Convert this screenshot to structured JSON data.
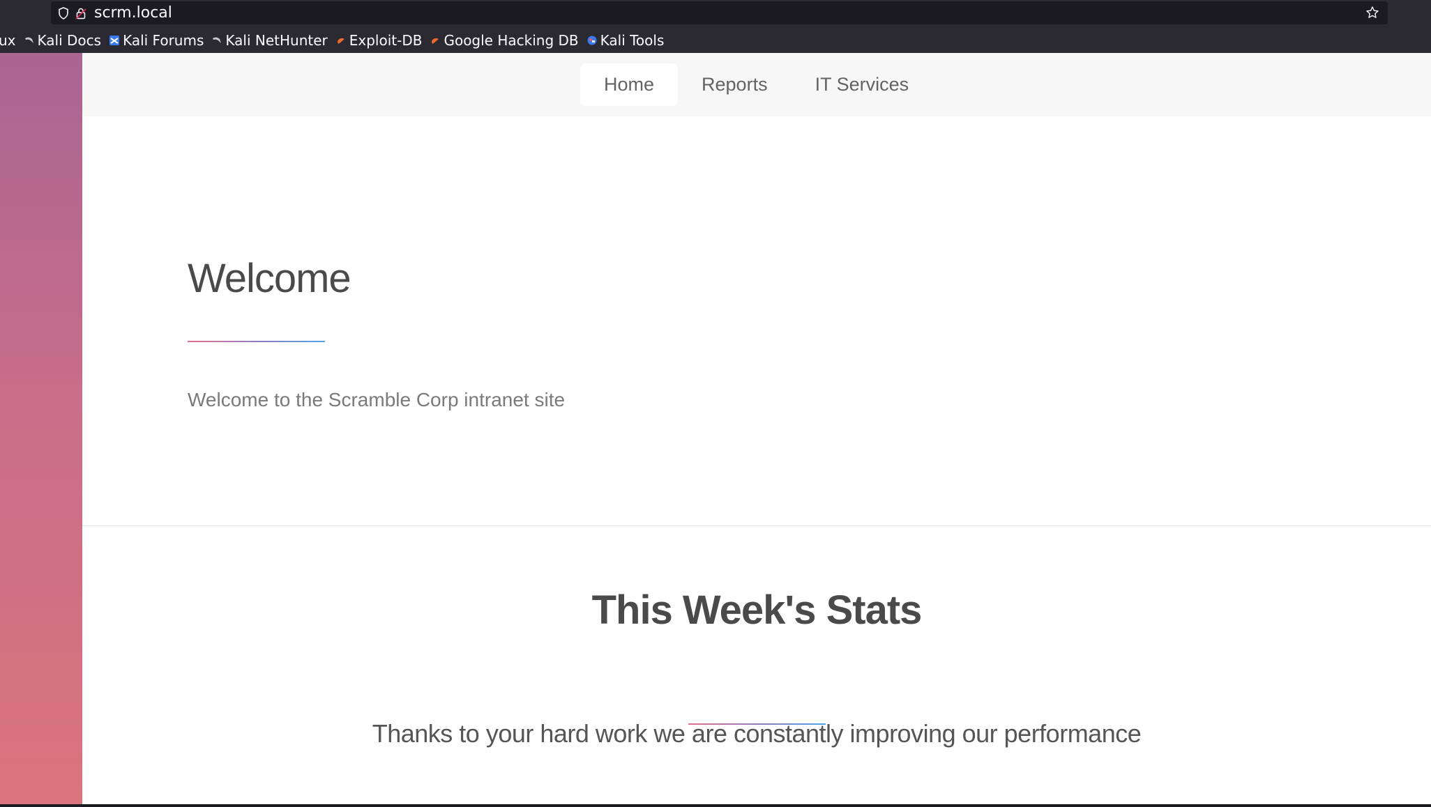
{
  "browser": {
    "url": "scrm.local",
    "bookmarks": [
      {
        "label": "ux",
        "icon": "truncated"
      },
      {
        "label": "Kali Docs",
        "icon": "kali-dragon-icon"
      },
      {
        "label": "Kali Forums",
        "icon": "kali-forums-icon"
      },
      {
        "label": "Kali NetHunter",
        "icon": "kali-dragon-icon"
      },
      {
        "label": "Exploit-DB",
        "icon": "exploit-db-icon"
      },
      {
        "label": "Google Hacking DB",
        "icon": "exploit-db-icon"
      },
      {
        "label": "Kali Tools",
        "icon": "kali-tools-icon"
      }
    ]
  },
  "nav": {
    "items": [
      {
        "label": "Home",
        "active": true
      },
      {
        "label": "Reports",
        "active": false
      },
      {
        "label": "IT Services",
        "active": false
      }
    ]
  },
  "welcome": {
    "heading": "Welcome",
    "text": "Welcome to the Scramble Corp intranet site"
  },
  "stats": {
    "heading": "This Week's Stats",
    "text": "Thanks to your hard work we are constantly improving our performance"
  },
  "colors": {
    "chrome_bg": "#2b2a33",
    "urlbar_bg": "#1c1b22",
    "accent_pink": "#e3708d",
    "accent_blue": "#4da7e8"
  }
}
